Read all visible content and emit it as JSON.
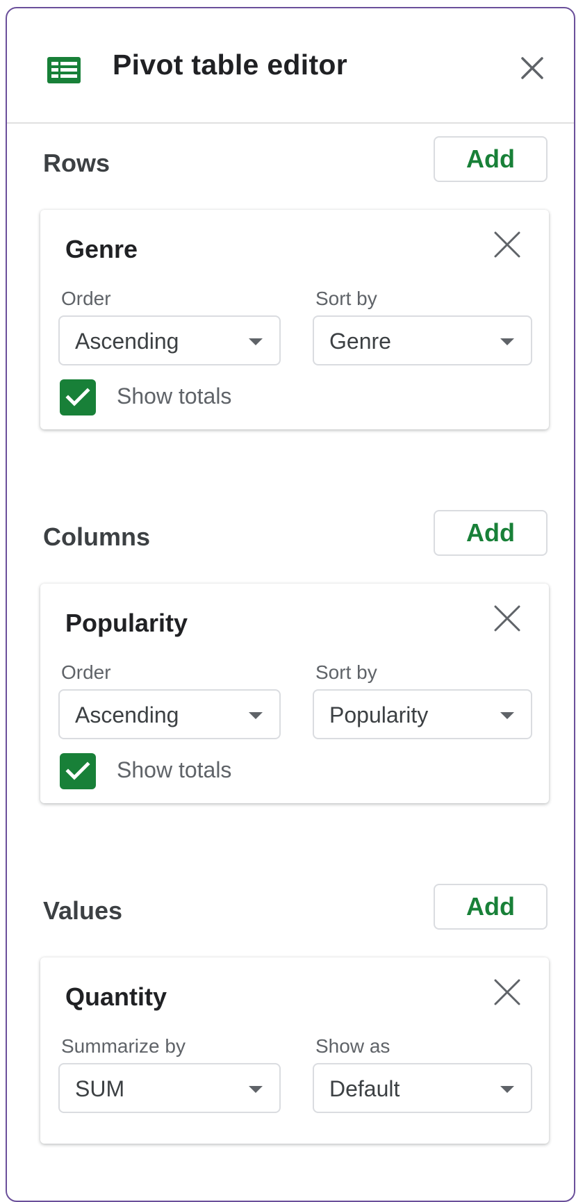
{
  "header": {
    "title": "Pivot table editor"
  },
  "sections": {
    "rows": {
      "label": "Rows",
      "add_label": "Add",
      "card": {
        "title": "Genre",
        "left_label": "Order",
        "left_value": "Ascending",
        "right_label": "Sort by",
        "right_value": "Genre",
        "show_totals_label": "Show totals",
        "show_totals_checked": true
      }
    },
    "columns": {
      "label": "Columns",
      "add_label": "Add",
      "card": {
        "title": "Popularity",
        "left_label": "Order",
        "left_value": "Ascending",
        "right_label": "Sort by",
        "right_value": "Popularity",
        "show_totals_label": "Show totals",
        "show_totals_checked": true
      }
    },
    "values": {
      "label": "Values",
      "add_label": "Add",
      "card": {
        "title": "Quantity",
        "left_label": "Summarize by",
        "left_value": "SUM",
        "right_label": "Show as",
        "right_value": "Default"
      }
    }
  },
  "colors": {
    "accent": "#188038",
    "panel_border": "#6a4f9a",
    "text": "#3c4043"
  },
  "icons": {
    "app": "sheets-icon",
    "close": "close-icon",
    "dropdown": "dropdown-caret-icon",
    "check": "checkmark-icon"
  }
}
